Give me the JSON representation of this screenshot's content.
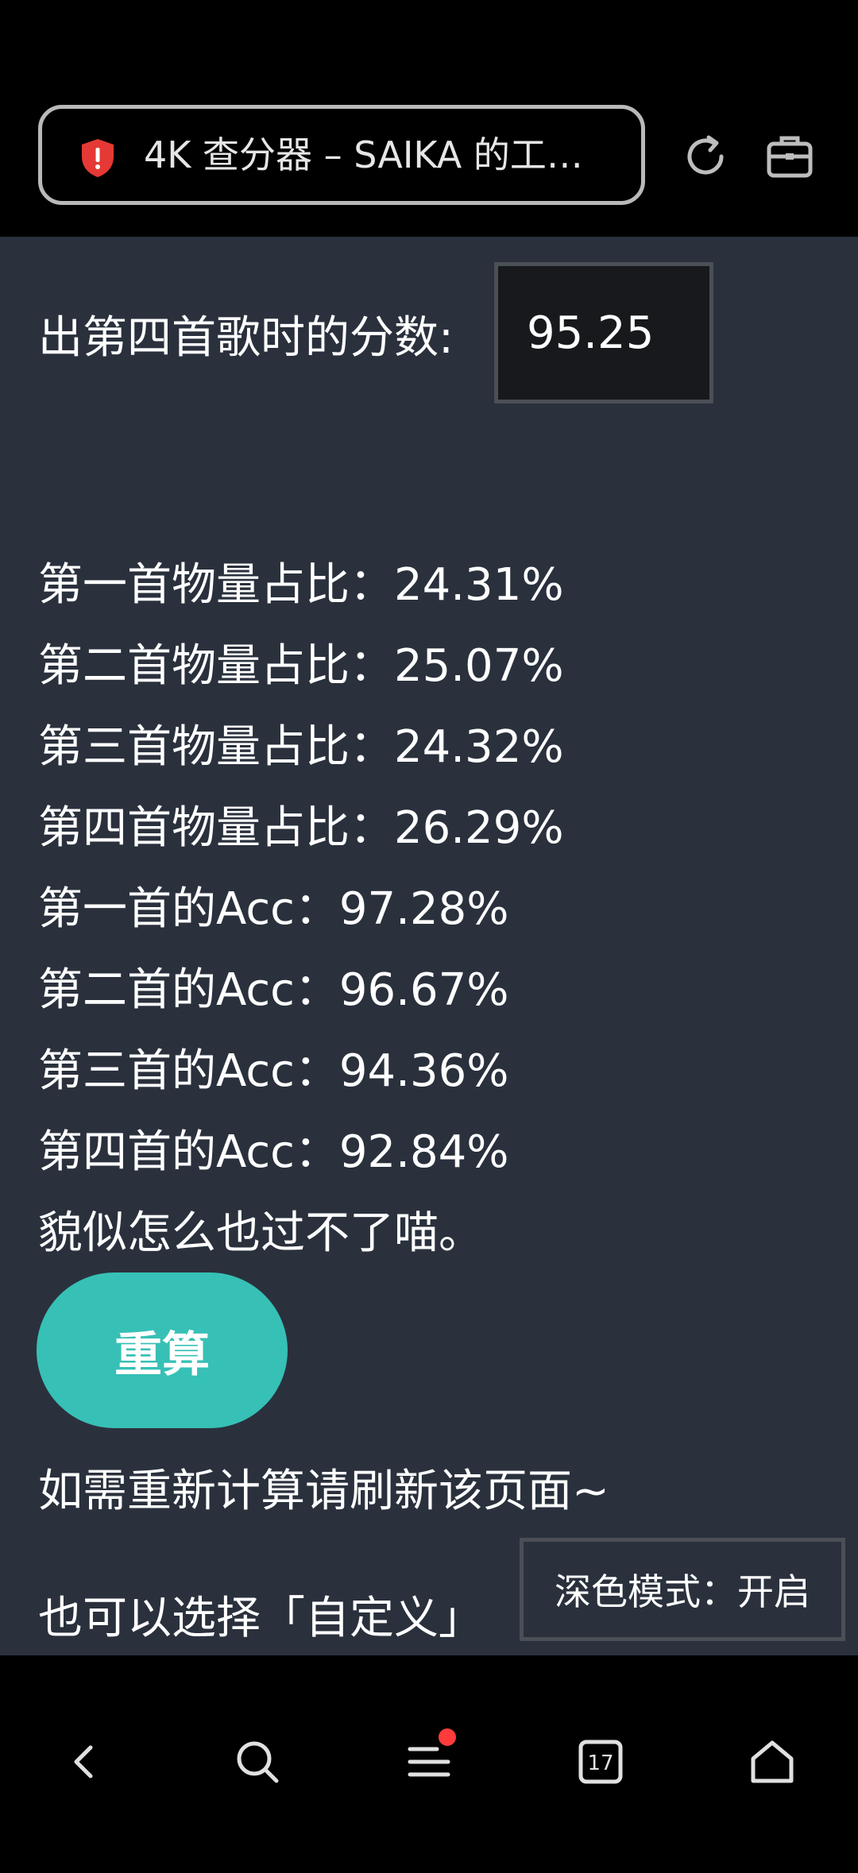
{
  "browser": {
    "url_title": "4K 查分器 – SAIKA 的工…",
    "security_color": "#e53935"
  },
  "page": {
    "score_label": "出第四首歌时的分数:",
    "score_value": "95.25",
    "results": [
      "第一首物量占比：24.31%",
      "第二首物量占比：25.07%",
      "第三首物量占比：24.32%",
      "第四首物量占比：26.29%",
      "第一首的Acc：97.28%",
      "第二首的Acc：96.67%",
      "第三首的Acc：94.36%",
      "第四首的Acc：92.84%",
      "貌似怎么也过不了喵。"
    ],
    "recalc_label": "重算",
    "hint_refresh": "如需重新计算请刷新该页面~",
    "hint_custom": "也可以选择「自定义」",
    "dark_mode_label": "深色模式：",
    "dark_mode_value": "开启",
    "accent_color": "#37c0b6",
    "background_color": "#2a313d"
  },
  "bottom_nav": {
    "tabs_count": "17",
    "items": [
      "back-icon",
      "search-icon",
      "menu-icon",
      "tabs-icon",
      "home-icon"
    ]
  }
}
